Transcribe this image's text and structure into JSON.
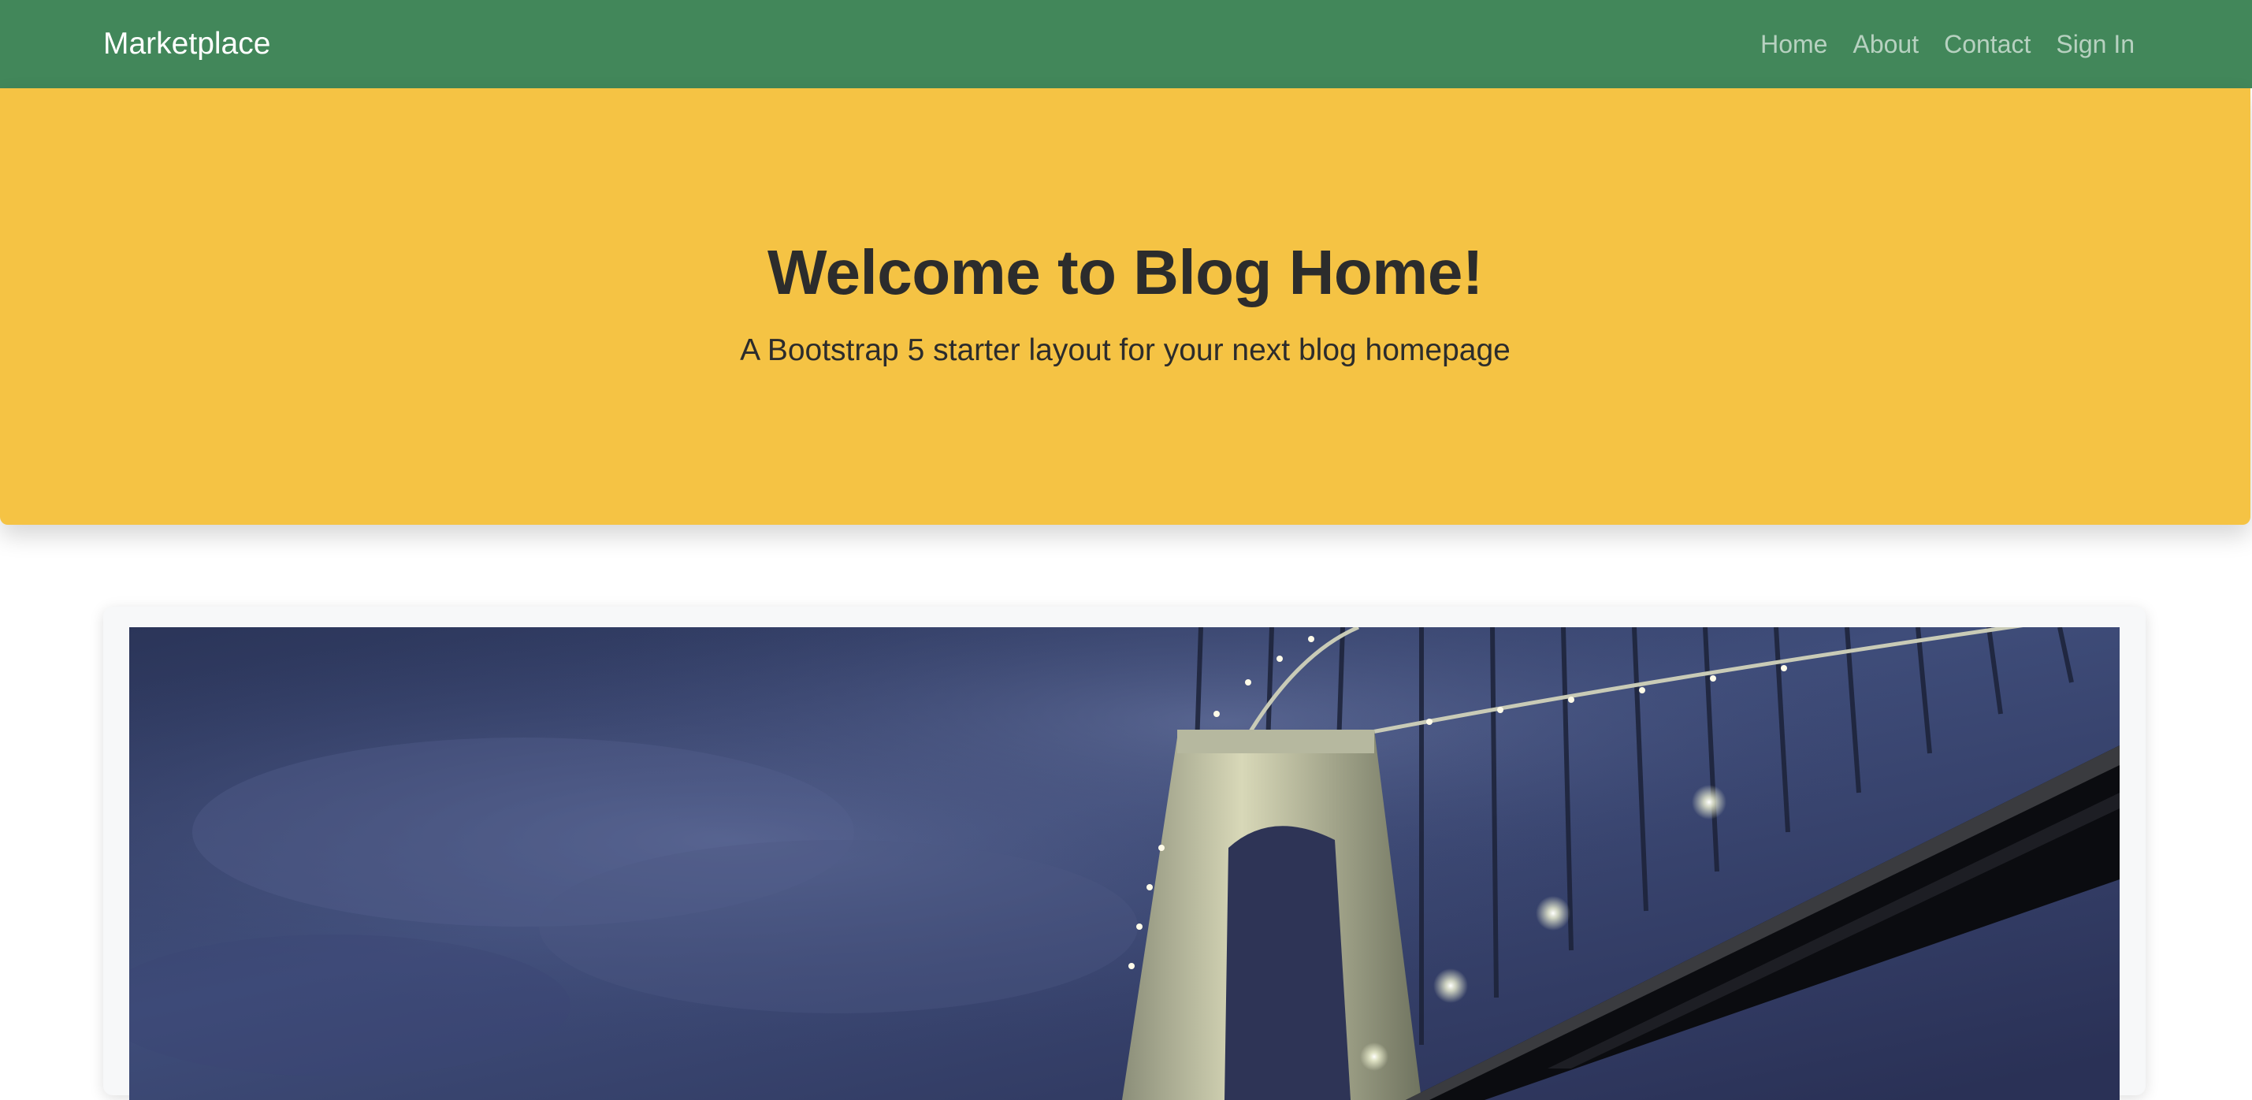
{
  "navbar": {
    "brand": "Marketplace",
    "links": [
      {
        "label": "Home"
      },
      {
        "label": "About"
      },
      {
        "label": "Contact"
      },
      {
        "label": "Sign In"
      }
    ],
    "background": "#42875a"
  },
  "hero": {
    "title": "Welcome to Blog Home!",
    "subtitle": "A Bootstrap 5 starter layout for your next blog homepage",
    "background": "#f5c344"
  },
  "featured_post": {
    "image_subject": "suspension bridge at night under cloudy sky"
  }
}
